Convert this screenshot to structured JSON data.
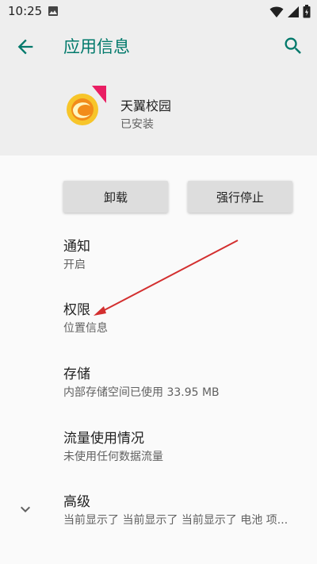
{
  "status_bar": {
    "time": "10:25",
    "icons": [
      "image-icon",
      "wifi-icon",
      "signal-icon",
      "battery-icon"
    ]
  },
  "app_bar": {
    "title": "应用信息",
    "back_icon": "back-arrow-icon",
    "search_icon": "search-icon",
    "accent_color": "#00796b"
  },
  "app": {
    "name": "天翼校园",
    "status": "已安装"
  },
  "buttons": {
    "uninstall": "卸载",
    "force_stop": "强行停止"
  },
  "settings": [
    {
      "title": "通知",
      "subtitle": "开启"
    },
    {
      "title": "权限",
      "subtitle": "位置信息"
    },
    {
      "title": "存储",
      "subtitle": "内部存储空间已使用 33.95 MB"
    },
    {
      "title": "流量使用情况",
      "subtitle": "未使用任何数据流量"
    },
    {
      "title": "高级",
      "subtitle": "当前显示了 当前显示了 当前显示了 电池 项..."
    }
  ],
  "annotation": {
    "color": "#d32f2f"
  }
}
